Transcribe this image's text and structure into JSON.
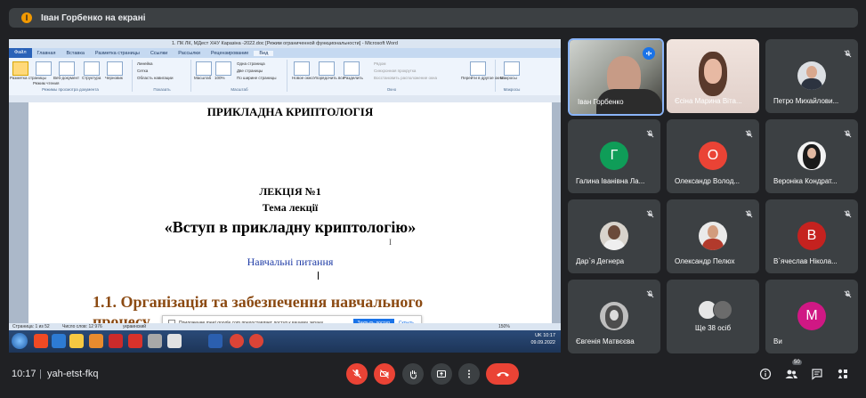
{
  "presenter_banner": {
    "icon_letter": "І",
    "text": "Іван Горбенко на екрані"
  },
  "word": {
    "title": "1. ПК ЛК, МДест ХНУ Каразіна -2022.doc [Режим ограниченной функциональности] - Microsoft Word",
    "tabs": [
      "Файл",
      "Главная",
      "Вставка",
      "Разметка страницы",
      "Ссылки",
      "Рассылки",
      "Рецензирование",
      "Вид"
    ],
    "ribbon": {
      "views": [
        "Разметка страницы",
        "Режим чтения",
        "Веб-документ",
        "Структура",
        "Черновик"
      ],
      "views_group": "Режимы просмотра документа",
      "show_items": [
        "Линейка",
        "Сетка",
        "Область навигации"
      ],
      "show_group": "Показать",
      "zoom_items": [
        "Масштаб",
        "100%",
        "Одна страница",
        "Две страницы",
        "По ширине страницы"
      ],
      "zoom_group": "Масштаб",
      "window_items": [
        "Новое окно",
        "Упорядочить все",
        "Разделить",
        "Рядом",
        "Синхронная прокрутка",
        "Восстановить расположение окна",
        "Перейти в другое окно"
      ],
      "window_group": "Окно",
      "macros": "Макросы",
      "macros_group": "Макросы"
    },
    "doc": {
      "heading_top": "ПРИКЛАДНА КРИПТОЛОГІЯ",
      "lecture": "ЛЕКЦІЯ №1",
      "topic_label": "Тема лекції",
      "topic": "«Вступ в прикладну криптологію»",
      "questions": "Навчальні питання",
      "section": "1.1. Організація та забезпечення навчального",
      "section_cont": "процесу"
    },
    "infobar": {
      "message": "Приложение meet.google.com предоставляет доступ к вашему экрану.",
      "share_button": "Закрыть доступ",
      "hide_button": "Скрыть"
    },
    "status": {
      "page": "Страница: 1 из 52",
      "words": "Число слов: 12 976",
      "lang": "украинский",
      "zoom": "150%"
    },
    "tray": {
      "lang": "UK",
      "time": "10:17",
      "date": "09.09.2022"
    }
  },
  "participants": [
    {
      "name": "Іван Горбенко",
      "type": "photo",
      "speaking": true
    },
    {
      "name": "Єсіна Марина Віта...",
      "type": "photo",
      "muted": false
    },
    {
      "name": "Петро Михайлови...",
      "type": "photo",
      "muted": true
    },
    {
      "name": "Галина Іванівна Ла...",
      "type": "letter",
      "letter": "Г",
      "color": "#0f9d58",
      "muted": true
    },
    {
      "name": "Олександр Волод...",
      "type": "letter",
      "letter": "О",
      "color": "#ea4335",
      "muted": true
    },
    {
      "name": "Вероніка Кондрат...",
      "type": "photo",
      "muted": true
    },
    {
      "name": "Дар`я Дегнера",
      "type": "photo",
      "muted": true
    },
    {
      "name": "Олександр Пелюх",
      "type": "photo",
      "muted": true
    },
    {
      "name": "В`ячеслав Нікола...",
      "type": "letter",
      "letter": "В",
      "color": "#c5221f",
      "muted": true
    },
    {
      "name": "Євгенія Матвєєва",
      "type": "photo",
      "muted": true
    },
    {
      "name": "Ще 38 осіб",
      "type": "group",
      "muted": false
    },
    {
      "name": "Ви",
      "type": "letter",
      "letter": "M",
      "color": "#d01884",
      "muted": true
    }
  ],
  "bottom": {
    "time": "10:17",
    "separator": "|",
    "meeting_code": "yah-etst-fkq",
    "participants_count": "50"
  },
  "colors": {
    "bg": "#202124",
    "tile": "#3c4043",
    "red": "#ea4335",
    "accent": "#1a73e8"
  }
}
